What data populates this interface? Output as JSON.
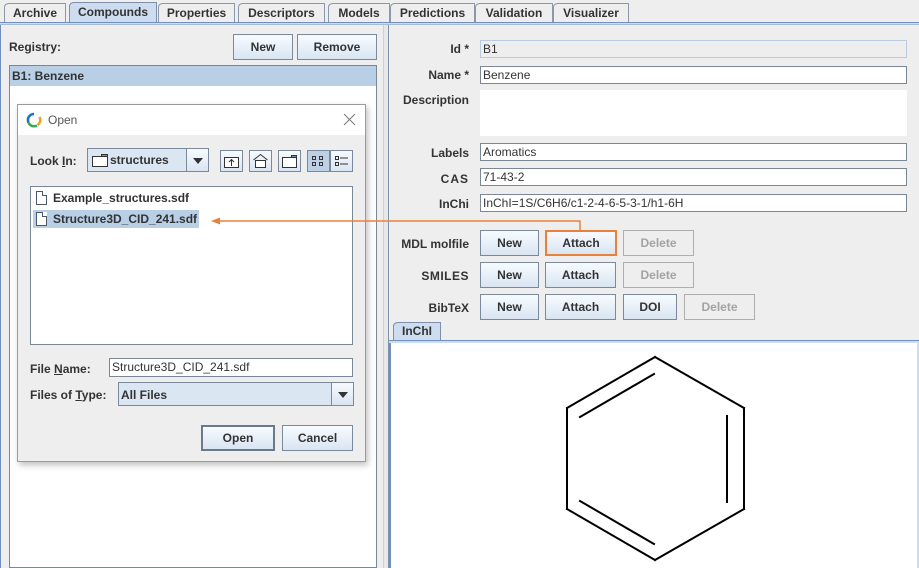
{
  "tabs": [
    {
      "label": "Archive",
      "active": false
    },
    {
      "label": "Compounds",
      "active": true
    },
    {
      "label": "Properties",
      "active": false
    },
    {
      "label": "Descriptors",
      "active": false
    },
    {
      "label": "Models",
      "active": false
    },
    {
      "label": "Predictions",
      "active": false
    },
    {
      "label": "Validation",
      "active": false
    },
    {
      "label": "Visualizer",
      "active": false
    }
  ],
  "registry": {
    "label": "Registry:",
    "new_label": "New",
    "remove_label": "Remove",
    "items": [
      {
        "label": "B1: Benzene",
        "selected": true
      }
    ]
  },
  "form": {
    "id": {
      "label": "Id *",
      "value": "B1"
    },
    "name": {
      "label": "Name *",
      "value": "Benzene"
    },
    "description": {
      "label": "Description",
      "value": ""
    },
    "labels": {
      "label": "Labels",
      "value": "Aromatics"
    },
    "cas": {
      "label": "CAS",
      "value": "71-43-2"
    },
    "inchi": {
      "label": "InChi",
      "value": "InChI=1S/C6H6/c1-2-4-6-5-3-1/h1-6H"
    },
    "mdl": {
      "label": "MDL molfile",
      "new": "New",
      "attach": "Attach",
      "delete": "Delete"
    },
    "smiles": {
      "label": "SMILES",
      "new": "New",
      "attach": "Attach",
      "delete": "Delete"
    },
    "bibtex": {
      "label": "BibTeX",
      "new": "New",
      "attach": "Attach",
      "doi": "DOI",
      "delete": "Delete"
    }
  },
  "viewer": {
    "tab_label": "InChI",
    "molecule": "benzene"
  },
  "open_dialog": {
    "title": "Open",
    "look_in_label_pre": "Look ",
    "look_in_label_mnemonic": "I",
    "look_in_label_post": "n:",
    "look_in_value": "structures",
    "files": [
      {
        "name": "Example_structures.sdf",
        "selected": false
      },
      {
        "name": "Structure3D_CID_241.sdf",
        "selected": true
      }
    ],
    "file_name_label_pre": "File ",
    "file_name_label_mnemonic": "N",
    "file_name_label_post": "ame:",
    "file_name_value": "Structure3D_CID_241.sdf",
    "files_of_type_label_pre": "Files of ",
    "files_of_type_label_mnemonic": "T",
    "files_of_type_label_post": "ype:",
    "files_of_type_value": "All Files",
    "open_label": "Open",
    "cancel_label": "Cancel"
  },
  "annotation": {
    "color": "#e8823b"
  }
}
